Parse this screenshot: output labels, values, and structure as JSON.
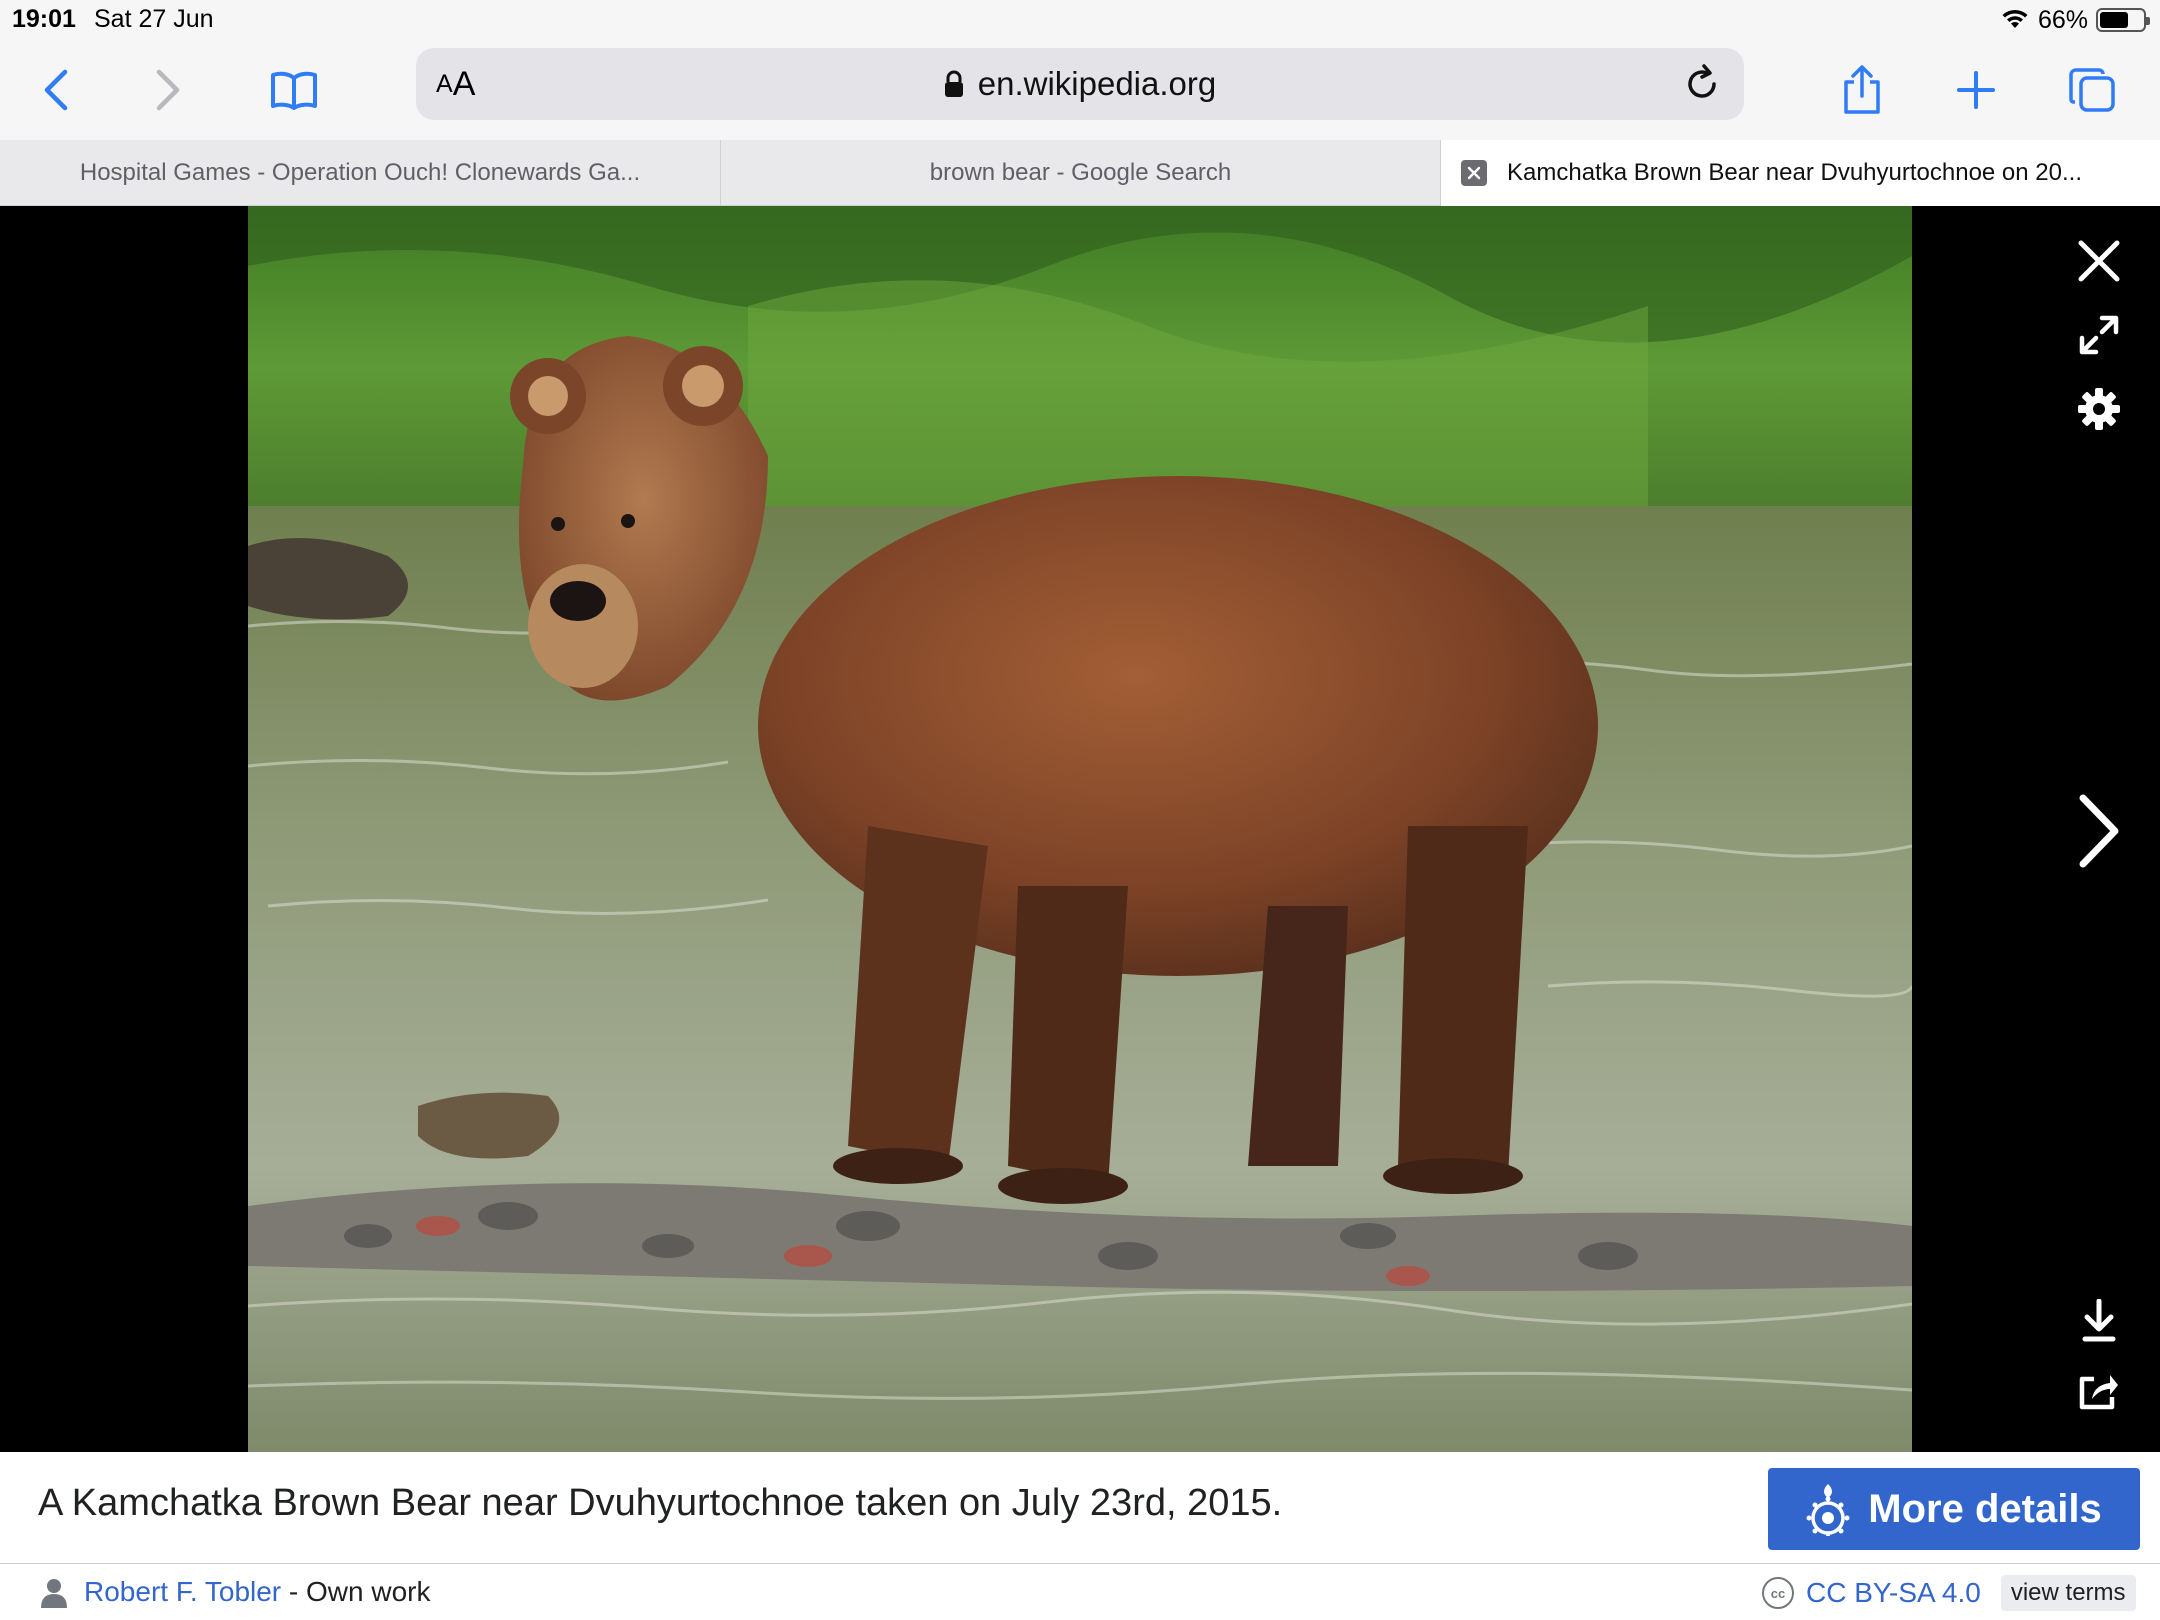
{
  "status_bar": {
    "time": "19:01",
    "date": "Sat 27 Jun",
    "battery": "66%",
    "battery_level": 0.66
  },
  "toolbar": {
    "reader_label_small": "A",
    "reader_label_large": "A",
    "url": "en.wikipedia.org",
    "accent_color": "#2f7cf6"
  },
  "tabs": [
    {
      "label": "Hospital Games - Operation Ouch! Clonewards Ga..."
    },
    {
      "label": "brown bear - Google Search"
    },
    {
      "label": "Kamchatka Brown Bear near Dvuhyurtochnoe on 20..."
    }
  ],
  "lightbox": {
    "image_subject": "brown-bear-in-river",
    "caption": "A Kamchatka Brown Bear near Dvuhyurtochnoe taken on July 23rd, 2015.",
    "more_details_label": "More details",
    "author_name": "Robert F. Tobler",
    "author_suffix": " - Own work",
    "license_label": "CC BY-SA 4.0",
    "license_icon_text": "cc",
    "view_terms_label": "view terms",
    "brand_color": "#3366cc"
  }
}
